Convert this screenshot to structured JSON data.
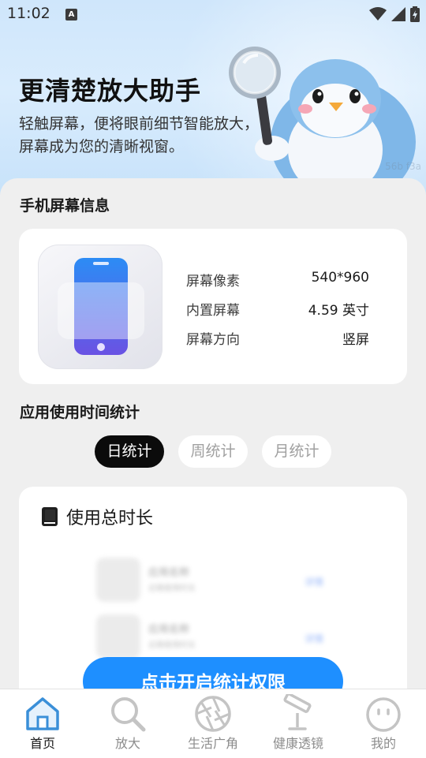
{
  "status": {
    "time": "11:02",
    "notification_glyph": "A"
  },
  "hero": {
    "title": "更清楚放大助手",
    "subtitle": "轻触屏幕，便将眼前细节智能放大，屏幕成为您的清晰视窗。",
    "watermark": "56b f3a"
  },
  "screen_info": {
    "section_title": "手机屏幕信息",
    "rows": [
      {
        "label": "屏幕像素",
        "value": "540*960"
      },
      {
        "label": "内置屏幕",
        "value": "4.59 英寸"
      },
      {
        "label": "屏幕方向",
        "value": "竖屏"
      }
    ]
  },
  "usage": {
    "section_title": "应用使用时间统计",
    "tabs": [
      {
        "label": "日统计",
        "active": true
      },
      {
        "label": "周统计",
        "active": false
      },
      {
        "label": "月统计",
        "active": false
      }
    ],
    "card_title": "使用总时长",
    "placeholder_rows": [
      {
        "name": "应用名称",
        "detail": "近期使用时长",
        "action": "详情"
      },
      {
        "name": "应用名称",
        "detail": "近期使用时长",
        "action": "详情"
      }
    ],
    "permission_button": "点击开启统计权限"
  },
  "nav": {
    "items": [
      {
        "label": "首页",
        "icon": "home-icon",
        "active": true
      },
      {
        "label": "放大",
        "icon": "magnifier-icon",
        "active": false
      },
      {
        "label": "生活广角",
        "icon": "camera-aperture-icon",
        "active": false
      },
      {
        "label": "健康透镜",
        "icon": "telescope-icon",
        "active": false
      },
      {
        "label": "我的",
        "icon": "smiley-face-icon",
        "active": false
      }
    ]
  },
  "colors": {
    "accent": "#1e8fff",
    "active_tab": "#0b0b0b",
    "nav_active_icon": "#3a8fd8",
    "nav_inactive_icon": "#c4c4c4"
  }
}
